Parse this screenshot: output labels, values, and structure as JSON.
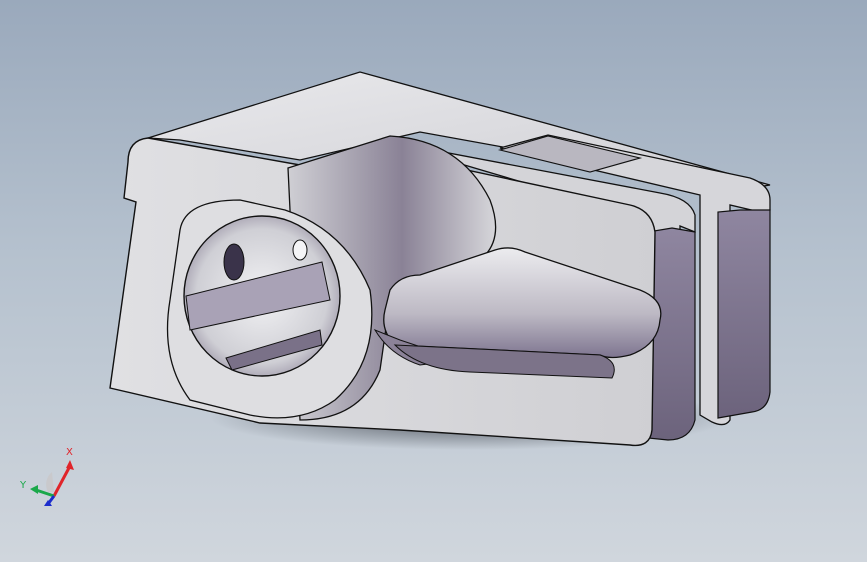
{
  "viewport": {
    "background_top": "#9aa9bc",
    "background_bottom": "#d0d6dd"
  },
  "model": {
    "face_color": "#d9d9dc",
    "shade_color": "#7d7688",
    "edge_color": "#111111"
  },
  "triad": {
    "x_label": "X",
    "y_label": "Y",
    "x_color": "#e0242a",
    "y_color": "#1aa84a",
    "z_color": "#1c2dcc"
  }
}
